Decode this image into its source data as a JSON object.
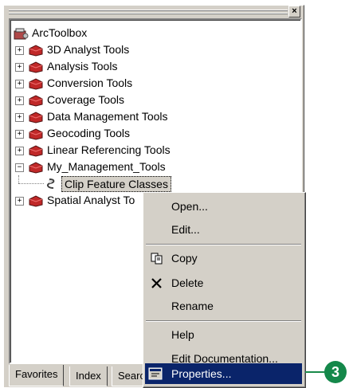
{
  "toolbox": {
    "root_label": "ArcToolbox",
    "items": [
      {
        "label": "3D Analyst Tools",
        "expanded": false
      },
      {
        "label": "Analysis Tools",
        "expanded": false
      },
      {
        "label": "Conversion Tools",
        "expanded": false
      },
      {
        "label": "Coverage Tools",
        "expanded": false
      },
      {
        "label": "Data Management Tools",
        "expanded": false
      },
      {
        "label": "Geocoding Tools",
        "expanded": false
      },
      {
        "label": "Linear Referencing Tools",
        "expanded": false
      },
      {
        "label": "My_Management_Tools",
        "expanded": true
      },
      {
        "label": "Clip Feature Classes",
        "selected": true
      },
      {
        "label": "Spatial Analyst To",
        "expanded": false
      }
    ]
  },
  "tabs": [
    "Favorites",
    "Index",
    "Searc"
  ],
  "context_menu": {
    "open": "Open...",
    "edit": "Edit...",
    "copy": "Copy",
    "delete": "Delete",
    "rename": "Rename",
    "help": "Help",
    "edit_documentation": "Edit Documentation...",
    "properties": "Properties..."
  },
  "callout": "3",
  "colors": {
    "selection": "#0a246a",
    "callout": "#14884a",
    "panel": "#d4d0c8"
  }
}
